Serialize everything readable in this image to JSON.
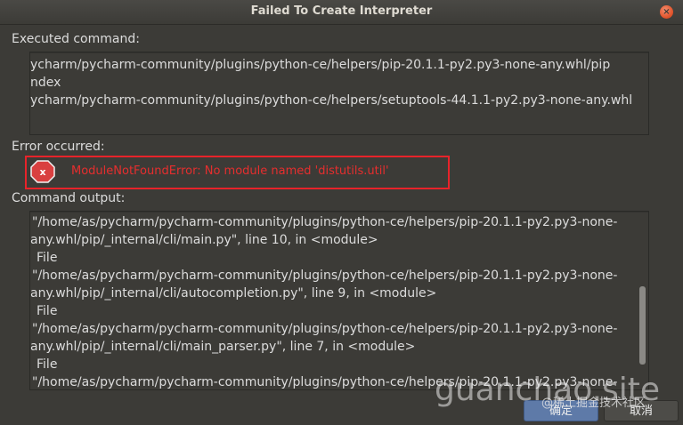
{
  "window": {
    "title": "Failed To Create Interpreter",
    "close_glyph": "×"
  },
  "executed": {
    "label": "Executed command:",
    "lines": [
      "ycharm/pycharm-community/plugins/python-ce/helpers/pip-20.1.1-py2.py3-none-any.whl/pip",
      "ndex",
      "ycharm/pycharm-community/plugins/python-ce/helpers/setuptools-44.1.1-py2.py3-none-any.whl"
    ]
  },
  "error": {
    "label": "Error occurred:",
    "message": "ModuleNotFoundError: No module named 'distutils.util'",
    "icon": "error-x-icon",
    "icon_glyph": "x",
    "highlight_color": "#e8232a"
  },
  "output": {
    "label": "Command output:",
    "lines": [
      "\"/home/as/pycharm/pycharm-community/plugins/python-ce/helpers/pip-20.1.1-py2.py3-none-",
      "any.whl/pip/_internal/cli/main.py\", line 10, in <module>",
      "File",
      "\"/home/as/pycharm/pycharm-community/plugins/python-ce/helpers/pip-20.1.1-py2.py3-none-",
      "any.whl/pip/_internal/cli/autocompletion.py\", line 9, in <module>",
      "File",
      "\"/home/as/pycharm/pycharm-community/plugins/python-ce/helpers/pip-20.1.1-py2.py3-none-",
      "any.whl/pip/_internal/cli/main_parser.py\", line 7, in <module>",
      "File",
      "\"/home/as/pycharm/pycharm-community/plugins/python-ce/helpers/pip-20.1.1-py2.py3-none-"
    ]
  },
  "buttons": {
    "ok": "确定",
    "cancel": "取消"
  },
  "watermark": {
    "text": "guanchao.site",
    "sub": "@稀土掘金技术社区"
  }
}
